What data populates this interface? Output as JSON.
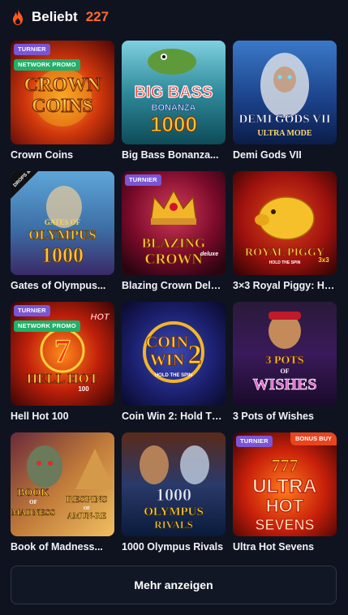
{
  "header": {
    "icon": "flame-icon",
    "title": "Beliebt",
    "count": "227",
    "count_color": "#ff6a2a"
  },
  "games": [
    {
      "title": "Crown Coins",
      "badges": [
        "TURNIER",
        "NETWORK PROMO"
      ],
      "art_text": [
        "CROWN",
        "COINS"
      ]
    },
    {
      "title": "Big Bass Bonanza...",
      "badges": [],
      "art_text": [
        "BIG BASS",
        "BONANZA",
        "1000"
      ]
    },
    {
      "title": "Demi Gods VII",
      "badges": [],
      "art_text": [
        "DEMI GODS VII",
        "ULTRA MODE"
      ]
    },
    {
      "title": "Gates of Olympus...",
      "badges": [],
      "art_text": [
        "DROPS & WINS",
        "GATES OF",
        "OLYMPUS",
        "1000"
      ]
    },
    {
      "title": "Blazing Crown Deluxe",
      "badges": [
        "TURNIER"
      ],
      "art_text": [
        "BLAZING",
        "CROWN",
        "deluxe"
      ]
    },
    {
      "title": "3×3 Royal Piggy: Ho...",
      "badges": [],
      "art_text": [
        "ROYAL PIGGY",
        "HOLD THE SPIN",
        "3x3"
      ]
    },
    {
      "title": "Hell Hot 100",
      "badges": [
        "TURNIER",
        "NETWORK PROMO"
      ],
      "art_text": [
        "HOT",
        "7",
        "HELL HOT",
        "100"
      ]
    },
    {
      "title": "Coin Win 2: Hold Th...",
      "badges": [],
      "art_text": [
        "COIN",
        "WIN",
        "2",
        "HOLD THE SPIN"
      ]
    },
    {
      "title": "3 Pots of Wishes",
      "badges": [],
      "art_text": [
        "3 POTS",
        "OF",
        "WISHES"
      ]
    },
    {
      "title": "Book of Madness...",
      "badges": [],
      "art_text": [
        "BOOK",
        "OF",
        "MADNESS",
        "RESPINS",
        "OF",
        "AMUN-RE"
      ]
    },
    {
      "title": "1000 Olympus Rivals",
      "badges": [],
      "art_text": [
        "1000",
        "OLYMPUS",
        "RIVALS"
      ]
    },
    {
      "title": "Ultra Hot Sevens",
      "badges": [
        "TURNIER"
      ],
      "corner_badge": "BONUS BUY",
      "art_text": [
        "777",
        "ULTRA",
        "HOT",
        "SEVENS"
      ]
    }
  ],
  "more_button": "Mehr anzeigen",
  "colors": {
    "background": "#0f1320",
    "badge_purple": "#7a55d6",
    "badge_green": "#21b06a",
    "badge_red": "#e8451f",
    "accent": "#ff6a2a"
  }
}
